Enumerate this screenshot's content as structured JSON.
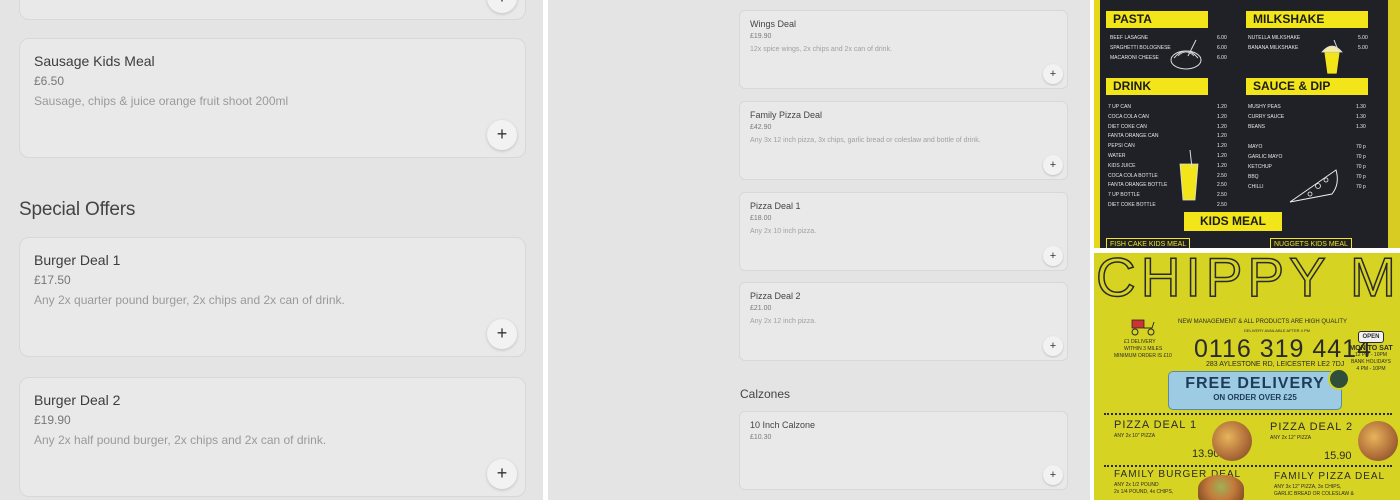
{
  "panel_left": {
    "partial_top_card_add": "+",
    "items_before": [
      {
        "name": "Sausage Kids Meal",
        "price": "£6.50",
        "description": "Sausage, chips & juice orange fruit shoot 200ml",
        "add_label": "+"
      }
    ],
    "section_title": "Special Offers",
    "items": [
      {
        "name": "Burger Deal 1",
        "price": "£17.50",
        "description": "Any 2x quarter pound burger, 2x chips and 2x can of drink.",
        "add_label": "+"
      },
      {
        "name": "Burger Deal 2",
        "price": "£19.90",
        "description": "Any 2x half pound burger, 2x chips and 2x can of drink.",
        "add_label": "+"
      }
    ]
  },
  "panel_middle": {
    "items": [
      {
        "name": "Wings Deal",
        "price": "£19.90",
        "description": "12x spice wings, 2x chips and 2x can of drink.",
        "add_label": "+"
      },
      {
        "name": "Family Pizza Deal",
        "price": "£42.90",
        "description": "Any 3x 12 inch pizza, 3x chips, garlic bread or coleslaw and bottle of drink.",
        "add_label": "+"
      },
      {
        "name": "Pizza Deal 1",
        "price": "£18.00",
        "description": "Any 2x 10 inch pizza.",
        "add_label": "+"
      },
      {
        "name": "Pizza Deal 2",
        "price": "£21.00",
        "description": "Any 2x 12 inch pizza.",
        "add_label": "+"
      }
    ],
    "section_title": "Calzones",
    "calzone_items": [
      {
        "name": "10 Inch Calzone",
        "price": "£10.30",
        "add_label": "+"
      }
    ]
  },
  "menu_photo": {
    "headers": {
      "pasta": "PASTA",
      "milkshake": "MILKSHAKE",
      "drink": "DRINK",
      "sauce": "SAUCE & DIP",
      "kids": "KIDS MEAL"
    },
    "pasta": [
      {
        "name": "BEEF LASAGNE",
        "price": "6.00"
      },
      {
        "name": "SPAGHETTI BOLOGNESE",
        "price": "6.00"
      },
      {
        "name": "MACARONI CHEESE",
        "price": "6.00"
      }
    ],
    "milkshake": [
      {
        "name": "NUTELLA MILKSHAKE",
        "price": "5.00"
      },
      {
        "name": "BANANA MILKSHAKE",
        "price": "5.00"
      }
    ],
    "drinks": [
      {
        "name": "7 UP CAN",
        "price": "1.20"
      },
      {
        "name": "COCA COLA CAN",
        "price": "1.20"
      },
      {
        "name": "DIET COKE CAN",
        "price": "1.20"
      },
      {
        "name": "FANTA ORANGE CAN",
        "price": "1.20"
      },
      {
        "name": "PEPSI CAN",
        "price": "1.20"
      },
      {
        "name": "WATER",
        "price": "1.20"
      },
      {
        "name": "KIDS JUICE",
        "price": "1.20"
      },
      {
        "name": "COCA COLA BOTTLE",
        "price": "2.50"
      },
      {
        "name": "FANTA ORANGE BOTTLE",
        "price": "2.50"
      },
      {
        "name": "7 UP BOTTLE",
        "price": "2.50"
      },
      {
        "name": "DIET COKE BOTTLE",
        "price": "2.50"
      }
    ],
    "sauces": [
      {
        "name": "MUSHY PEAS",
        "price": "1.30"
      },
      {
        "name": "CURRY SAUCE",
        "price": "1.30"
      },
      {
        "name": "BEANS",
        "price": "1.30"
      },
      {
        "name": "MAYO",
        "price": "70 p"
      },
      {
        "name": "GARLIC MAYO",
        "price": "70 p"
      },
      {
        "name": "KETCHUP",
        "price": "70 p"
      },
      {
        "name": "BBQ",
        "price": "70 p"
      },
      {
        "name": "CHILLI",
        "price": "70 p"
      }
    ],
    "bottom_labels": [
      "FISH CAKE KIDS MEAL",
      "NUGGETS KIDS MEAL"
    ]
  },
  "flyer": {
    "brand": "CHIPPY MAN",
    "tagline": "NEW MANAGEMENT & ALL PRODUCTS ARE HIGH QUALITY",
    "delivery_after": "DELIVERY AVAILABLE AFTER 4 PM",
    "phone": "0116 319 4414",
    "address": "283 AYLESTONE RD, LEICESTER  LE2 7DJ",
    "delivery_info": [
      "£1 DELIVERY",
      "WITHIN 3 MILES",
      "MINIMUM ORDER IS £10"
    ],
    "open_sign": "OPEN",
    "hours_title": "MON TO SAT",
    "hours": [
      "12 PM - 10PM",
      "BANK HOLIDAYS",
      "4 PM - 10PM"
    ],
    "banner_title": "FREE DELIVERY",
    "banner_sub": "ON ORDER OVER £25",
    "deals": [
      {
        "title": "PIZZA DEAL 1",
        "sub": "ANY 2x 10\" PIZZA",
        "price": "13.90"
      },
      {
        "title": "PIZZA DEAL 2",
        "sub": "ANY 2x 12\" PIZZA",
        "price": "15.90"
      }
    ],
    "more_deals": [
      {
        "title": "FAMILY BURGER DEAL",
        "sub": [
          "ANY 2x 1/2 POUND",
          "2x 1/4 POUND, 4x CHIPS,"
        ]
      },
      {
        "title": "FAMILY PIZZA DEAL",
        "sub": [
          "ANY 3x 12\" PIZZA, 3x CHIPS,",
          "GARLIC BREAD OR COLESLAW &"
        ]
      }
    ]
  }
}
